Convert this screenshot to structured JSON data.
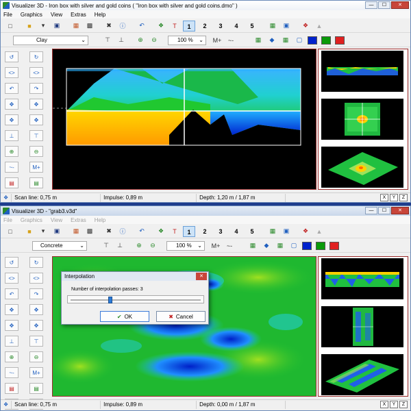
{
  "window1": {
    "title": "Visualizer 3D - Iron box with silver and gold coins ( \"Iron box with silver and gold coins.dmo\" )",
    "menu": [
      "File",
      "Graphics",
      "View",
      "Extras",
      "Help"
    ],
    "material": "Clay",
    "zoom": "100 %",
    "page_buttons": [
      "1",
      "2",
      "3",
      "4",
      "5"
    ],
    "active_page": "1",
    "status": {
      "scan_line": "Scan line: 0,75 m",
      "impulse": "Impulse: 0,89 m",
      "depth": "Depth: 1,20 m / 1,87 m"
    }
  },
  "window2": {
    "title": "Visualizer 3D - \"grab3.v3d\"",
    "menu": [
      "File",
      "Graphics",
      "View",
      "Extras",
      "Help"
    ],
    "material": "Concrete",
    "zoom": "100 %",
    "page_buttons": [
      "1",
      "2",
      "3",
      "4",
      "5"
    ],
    "active_page": "1",
    "status": {
      "scan_line": "Scan line: 0,75 m",
      "impulse": "Impulse: 0,89 m",
      "depth": "Depth: 0,00 m / 1,87 m"
    }
  },
  "dialog": {
    "title": "Interpolation",
    "label": "Number of interpolation passes:  3",
    "passes": 3,
    "max_passes": 10,
    "ok": "OK",
    "cancel": "Cancel"
  },
  "axis_buttons": [
    "X",
    "Y",
    "Z"
  ],
  "window_buttons": {
    "minimize": "—",
    "maximize": "☐",
    "close": "✕"
  },
  "colors": {
    "blue": "#0022cc",
    "green": "#0a9a0a",
    "red": "#e02020",
    "accent": "#1f5fbf"
  },
  "icons": [
    "new-file-icon",
    "open-folder-icon",
    "save-icon",
    "export-icon",
    "print-icon",
    "tools-icon",
    "info-icon",
    "undo-icon",
    "scan-icon",
    "text-icon",
    "zoom-in-icon",
    "zoom-out-icon",
    "rotate-icon",
    "split-icon",
    "move-icon"
  ]
}
